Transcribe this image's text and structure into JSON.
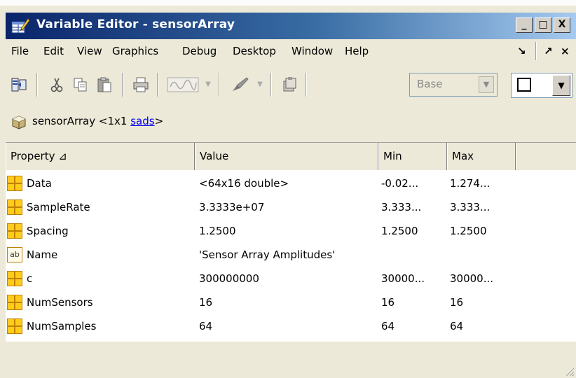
{
  "window": {
    "title": "Variable Editor - sensorArray",
    "icon": "variable-editor-icon",
    "caption_buttons": [
      "_",
      "□",
      "X"
    ],
    "colors": {
      "titlebar_start": "#0a246a",
      "titlebar_end": "#a6caf0",
      "chrome": "#ece9d8"
    }
  },
  "menu": {
    "items": [
      "File",
      "Edit",
      "View",
      "Graphics",
      "Debug",
      "Desktop",
      "Window",
      "Help"
    ],
    "right": [
      "↘",
      "↗",
      "×"
    ]
  },
  "toolbar": {
    "icons": [
      "import-icon",
      "cut-icon",
      "copy-icon",
      "paste-icon",
      "print-icon",
      "plot-icon",
      "plot-dropdown-icon",
      "brush-icon",
      "brush-dropdown-icon",
      "stack-icon"
    ],
    "base_label": "Base",
    "combo_arrow": "▼"
  },
  "path": {
    "variable": "sensorArray",
    "size_prefix": "<1x1",
    "class": "sads",
    "suffix": ">"
  },
  "table": {
    "headers": [
      "Property ⊿",
      "Value",
      "Min",
      "Max",
      ""
    ],
    "rows": [
      {
        "icon": "grid",
        "property": "Data",
        "value": "<64x16 double>",
        "min": "-0.02...",
        "max": "1.274..."
      },
      {
        "icon": "grid",
        "property": "SampleRate",
        "value": "3.3333e+07",
        "min": "3.333...",
        "max": "3.333..."
      },
      {
        "icon": "grid",
        "property": "Spacing",
        "value": "1.2500",
        "min": "1.2500",
        "max": "1.2500"
      },
      {
        "icon": "ab",
        "property": "Name",
        "value": "'Sensor Array Amplitudes'",
        "min": "",
        "max": ""
      },
      {
        "icon": "grid",
        "property": "c",
        "value": "300000000",
        "min": "30000...",
        "max": "30000..."
      },
      {
        "icon": "grid",
        "property": "NumSensors",
        "value": "16",
        "min": "16",
        "max": "16"
      },
      {
        "icon": "grid",
        "property": "NumSamples",
        "value": "64",
        "min": "64",
        "max": "64"
      }
    ],
    "ab_icon_text": "ab"
  }
}
